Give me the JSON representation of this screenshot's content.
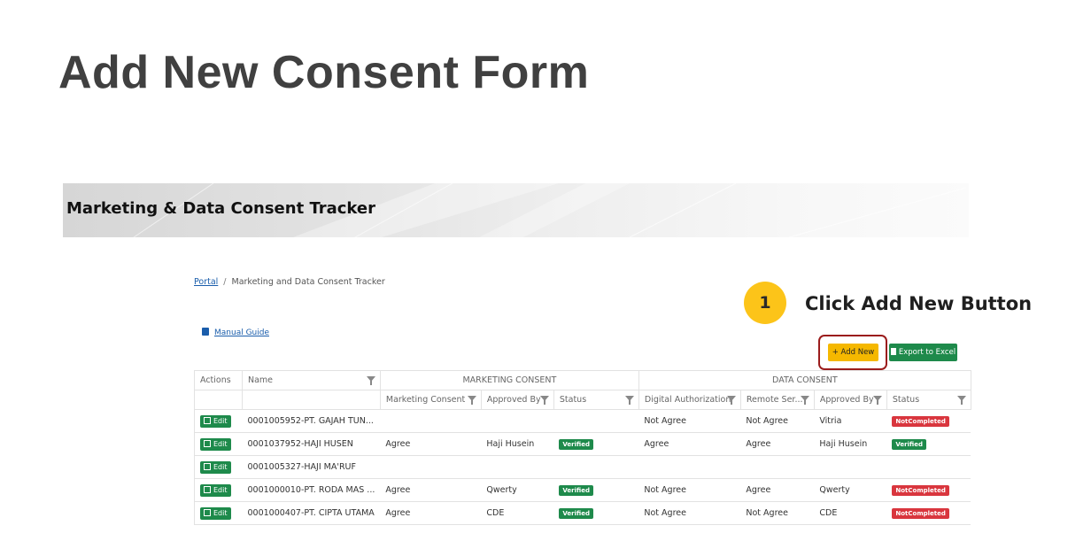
{
  "slide": {
    "title": "Add New Consent Form"
  },
  "banner": {
    "title": "Marketing & Data Consent Tracker"
  },
  "breadcrumb": {
    "root": "Portal",
    "separator": "/",
    "current": "Marketing and Data Consent Tracker"
  },
  "callout": {
    "number": "1",
    "text": "Click Add New Button"
  },
  "manual_guide": {
    "label": "Manual Guide",
    "icon": "book-icon"
  },
  "toolbar": {
    "add_label": "+ Add New",
    "export_label": "Export to Excel",
    "export_icon": "file-icon"
  },
  "table": {
    "headers": {
      "actions": "Actions",
      "name": "Name",
      "marketing_group": "MARKETING CONSENT",
      "data_group": "DATA CONSENT",
      "marketing_consent": "Marketing Consent",
      "approved_by": "Approved By",
      "status": "Status",
      "digital_authorization": "Digital Authorization",
      "remote_service": "Remote Ser...",
      "data_approved_by": "Approved By",
      "data_status": "Status"
    },
    "edit_label": "Edit",
    "rows": [
      {
        "name": "0001005952-PT. GAJAH TUN...",
        "marketing_consent": "",
        "approved_by": "",
        "status": "",
        "digital_authorization": "Not Agree",
        "remote_service": "Not Agree",
        "data_approved_by": "Vitria",
        "data_status": "NotCompleted"
      },
      {
        "name": "0001037952-HAJI HUSEN",
        "marketing_consent": "Agree",
        "approved_by": "Haji Husein",
        "status": "Verified",
        "digital_authorization": "Agree",
        "remote_service": "Agree",
        "data_approved_by": "Haji Husein",
        "data_status": "Verified"
      },
      {
        "name": "0001005327-HAJI MA'RUF",
        "marketing_consent": "",
        "approved_by": "",
        "status": "",
        "digital_authorization": "",
        "remote_service": "",
        "data_approved_by": "",
        "data_status": ""
      },
      {
        "name": "0001000010-PT. RODA MAS ...",
        "marketing_consent": "Agree",
        "approved_by": "Qwerty",
        "status": "Verified",
        "digital_authorization": "Not Agree",
        "remote_service": "Agree",
        "data_approved_by": "Qwerty",
        "data_status": "NotCompleted"
      },
      {
        "name": "0001000407-PT. CIPTA UTAMA",
        "marketing_consent": "Agree",
        "approved_by": "CDE",
        "status": "Verified",
        "digital_authorization": "Not Agree",
        "remote_service": "Not Agree",
        "data_approved_by": "CDE",
        "data_status": "NotCompleted"
      }
    ]
  },
  "colors": {
    "accent_yellow": "#f5b800",
    "success_green": "#1e8a4b",
    "danger_red": "#d9363e",
    "highlight_border": "#9b1c1c"
  }
}
